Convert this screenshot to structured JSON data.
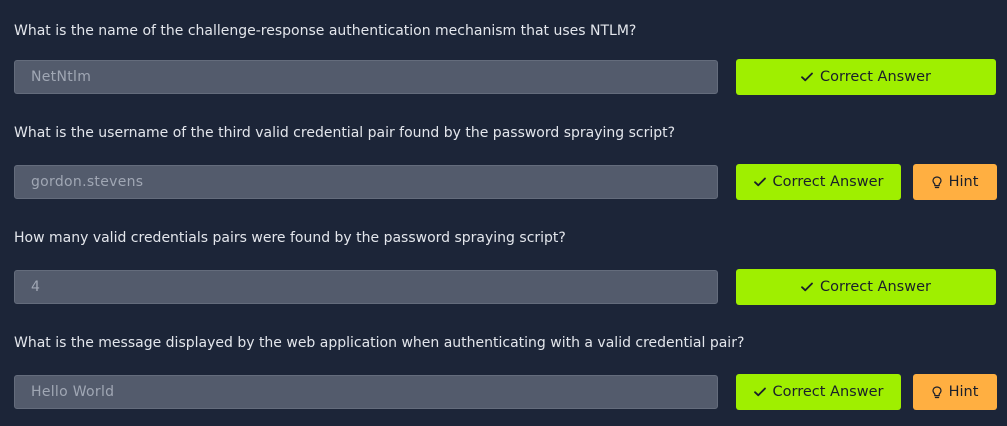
{
  "questions": [
    {
      "text": "What is the name of the challenge-response authentication mechanism that uses NTLM?",
      "answer": "NetNtlm",
      "correct_label": "Correct Answer",
      "has_hint": false
    },
    {
      "text": "What is the username of the third valid credential pair found by the password spraying script?",
      "answer": "gordon.stevens",
      "correct_label": "Correct Answer",
      "has_hint": true,
      "hint_label": "Hint"
    },
    {
      "text": "How many valid credentials pairs were found by the password spraying script?",
      "answer": "4",
      "correct_label": "Correct Answer",
      "has_hint": false
    },
    {
      "text": "What is the message displayed by the web application when authenticating with a valid credential pair?",
      "answer": "Hello World",
      "correct_label": "Correct Answer",
      "has_hint": true,
      "hint_label": "Hint"
    }
  ],
  "icons": {
    "correct": "check-icon",
    "hint": "lightbulb-icon"
  },
  "colors": {
    "background": "#1c2538",
    "correct_button": "#9fef00",
    "hint_button": "#ffaf41",
    "answer_field": "#535b6c"
  }
}
